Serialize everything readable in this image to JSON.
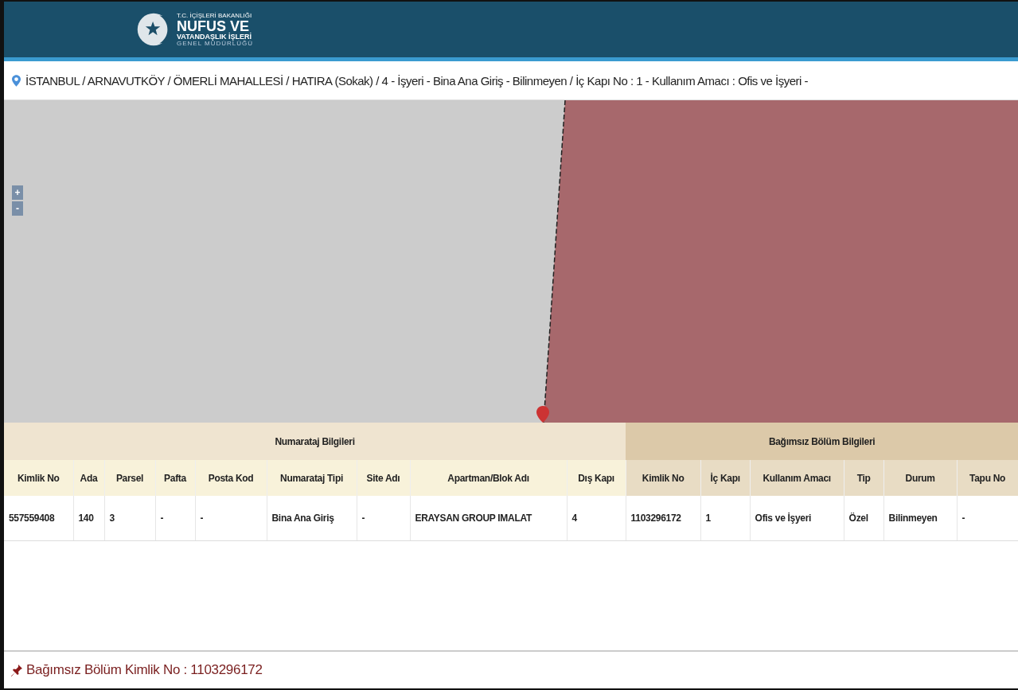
{
  "header": {
    "logo_lines": [
      "T.C. İÇİŞLERİ BAKANLIĞI",
      "NUFUS VE",
      "VATANDAŞLIK İŞLERİ",
      "GENEL MÜDÜRLÜĞÜ"
    ]
  },
  "address": "İSTANBUL / ARNAVUTKÖY / ÖMERLİ MAHALLESİ / HATIRA (Sokak) / 4 - İşyeri - Bina Ana Giriş - Bilinmeyen / İç Kapı No : 1 - Kullanım Amacı : Ofis ve İşyeri -",
  "map": {
    "kind": "picture",
    "zoom_buttons": [
      "+",
      "-"
    ]
  },
  "table": {
    "groups": [
      {
        "label": "Numarataj Bilgileri"
      },
      {
        "label": "Bağımsız Bölüm Bilgileri"
      }
    ],
    "columns": [
      "Kimlik No",
      "Ada",
      "Parsel",
      "Pafta",
      "Posta Kod",
      "Numarataj Tipi",
      "Site Adı",
      "Apartman/Blok Adı",
      "Dış Kapı",
      "Kimlik No",
      "İç Kapı",
      "Kullanım Amacı",
      "Tip",
      "Durum",
      "Tapu No"
    ],
    "rows": [
      [
        "557559408",
        "140",
        "3",
        "-",
        "-",
        "Bina Ana Giriş",
        "-",
        "ERAYSAN GROUP IMALAT",
        "4",
        "1103296172",
        "1",
        "Ofis ve İşyeri",
        "Özel",
        "Bilinmeyen",
        "-"
      ]
    ]
  },
  "footer": "Bağımsız Bölüm Kimlik No : 1103296172"
}
